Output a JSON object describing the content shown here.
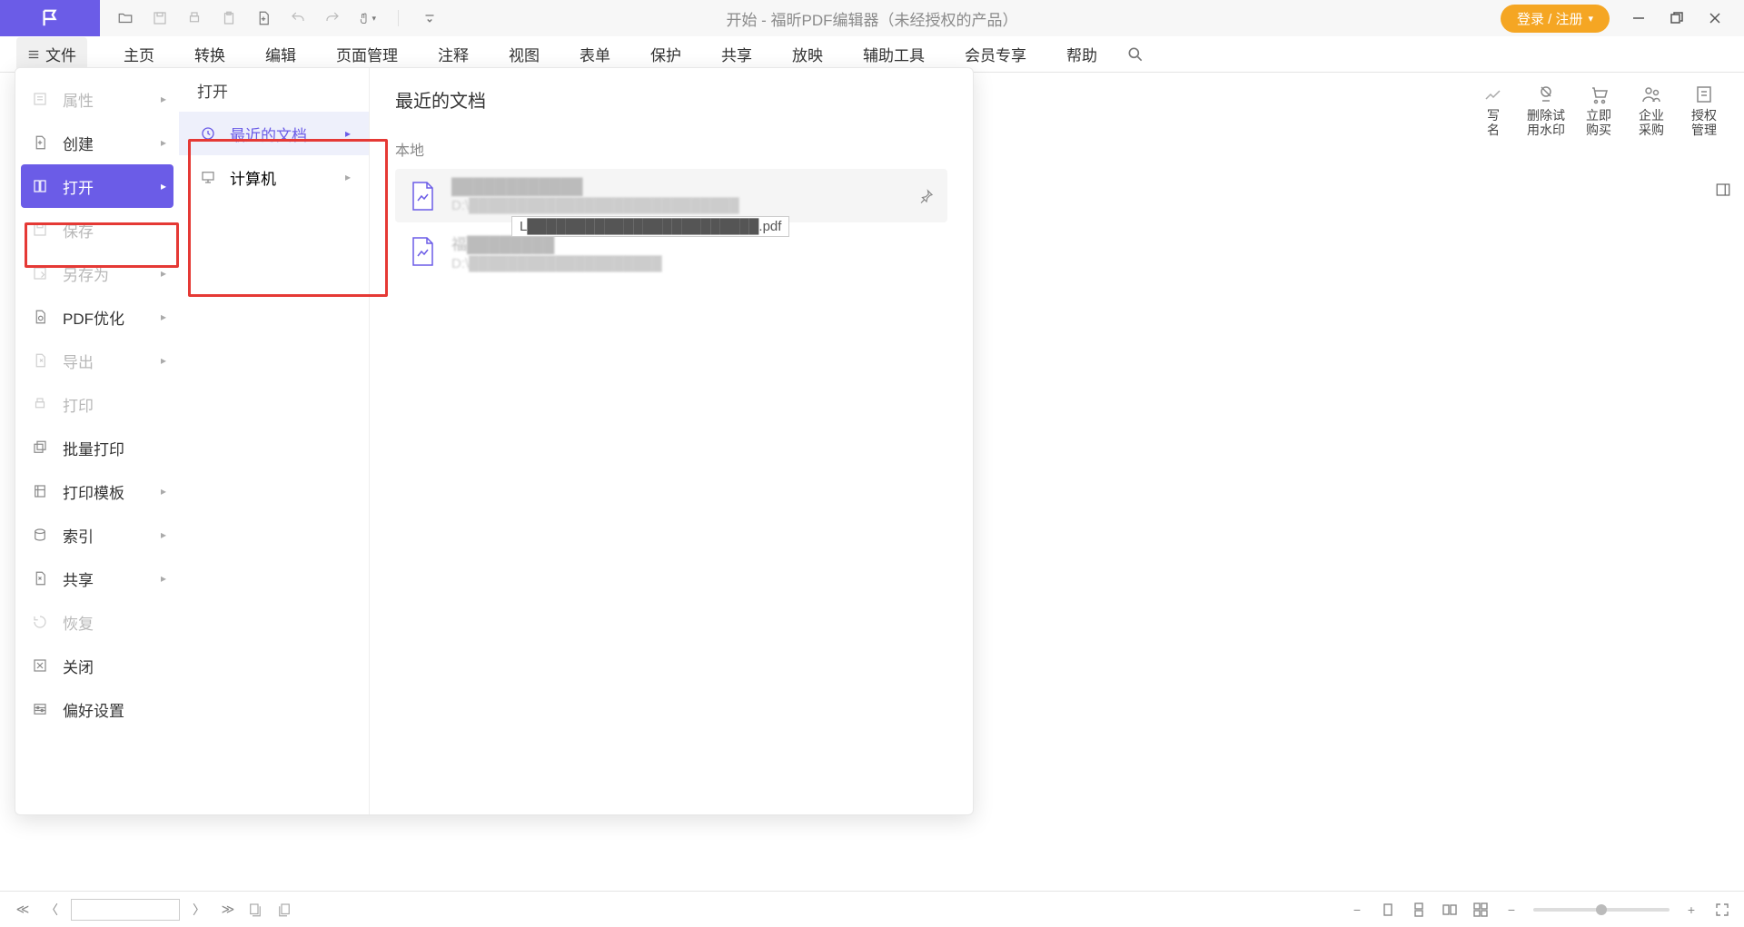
{
  "titlebar": {
    "title": "开始 - 福昕PDF编辑器（未经授权的产品）",
    "login_label": "登录 / 注册"
  },
  "ribbon": {
    "file_label": "文件",
    "tabs": [
      "主页",
      "转换",
      "编辑",
      "页面管理",
      "注释",
      "视图",
      "表单",
      "保护",
      "共享",
      "放映",
      "辅助工具",
      "会员专享",
      "帮助"
    ]
  },
  "action_strip": {
    "a0": "写\n名",
    "a1": "删除试\n用水印",
    "a2": "立即\n购买",
    "a3": "企业\n采购",
    "a4": "授权\n管理"
  },
  "file_menu": {
    "items": [
      {
        "label": "属性",
        "dim": true,
        "chev": true
      },
      {
        "label": "创建",
        "dim": false,
        "chev": true
      },
      {
        "label": "打开",
        "dim": false,
        "chev": true,
        "active": true
      },
      {
        "label": "保存",
        "dim": true,
        "chev": false
      },
      {
        "label": "另存为",
        "dim": true,
        "chev": true
      },
      {
        "label": "PDF优化",
        "dim": false,
        "chev": true
      },
      {
        "label": "导出",
        "dim": true,
        "chev": true
      },
      {
        "label": "打印",
        "dim": true,
        "chev": false
      },
      {
        "label": "批量打印",
        "dim": false,
        "chev": false
      },
      {
        "label": "打印模板",
        "dim": false,
        "chev": true
      },
      {
        "label": "索引",
        "dim": false,
        "chev": true
      },
      {
        "label": "共享",
        "dim": false,
        "chev": true
      },
      {
        "label": "恢复",
        "dim": true,
        "chev": false
      },
      {
        "label": "关闭",
        "dim": false,
        "chev": false
      },
      {
        "label": "偏好设置",
        "dim": false,
        "chev": false
      }
    ],
    "sub_header": "打开",
    "sub_items": [
      {
        "label": "最近的文档",
        "active": true
      },
      {
        "label": "计算机",
        "active": false
      }
    ]
  },
  "recent": {
    "title": "最近的文档",
    "section": "本地",
    "doc1_name": "████████████",
    "doc1_path": "D:\\████████████████████████████",
    "doc1_tooltip": "L████████████████████████.pdf",
    "doc2_name": "福████████",
    "doc2_path": "D:\\████████████████████"
  }
}
